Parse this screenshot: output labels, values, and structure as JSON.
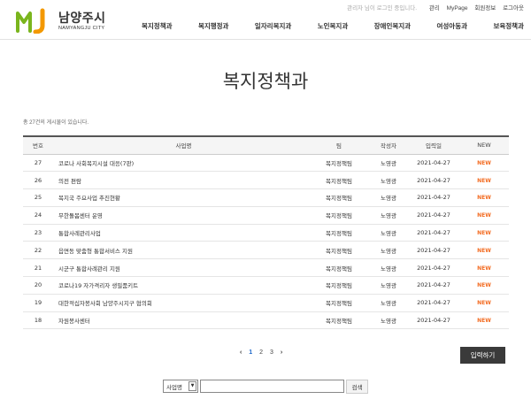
{
  "brand": {
    "name": "남양주시",
    "sub": "NAMYANGJU CITY",
    "mark_letters": "MJ",
    "colors": {
      "green": "#7ab51d",
      "orange": "#f39800"
    }
  },
  "util": {
    "welcome": "관리자 님이 로그인 중입니다.",
    "links": [
      "관리",
      "MyPage",
      "회원정보",
      "로그아웃"
    ]
  },
  "nav": [
    "복지정책과",
    "복지행정과",
    "일자리복지과",
    "노인복지과",
    "장애인복지과",
    "여성아동과",
    "보육정책과"
  ],
  "page": {
    "title": "복지정책과",
    "total_text": "총 27건의 게시물이 있습니다."
  },
  "table": {
    "headers": [
      "번호",
      "사업명",
      "팀",
      "작성자",
      "입력일",
      "NEW"
    ],
    "rows": [
      {
        "num": "27",
        "name": "코로나 사회복지시설 대응(7판)",
        "team": "복지정책팀",
        "writer": "노영광",
        "date": "2021-04-27",
        "new": "NEW"
      },
      {
        "num": "26",
        "name": "의전 편람",
        "team": "복지정책팀",
        "writer": "노영광",
        "date": "2021-04-27",
        "new": "NEW"
      },
      {
        "num": "25",
        "name": "복지국 주요사업 추진현황",
        "team": "복지정책팀",
        "writer": "노영광",
        "date": "2021-04-27",
        "new": "NEW"
      },
      {
        "num": "24",
        "name": "무한돌봄센터 운영",
        "team": "복지정책팀",
        "writer": "노영광",
        "date": "2021-04-27",
        "new": "NEW"
      },
      {
        "num": "23",
        "name": "통합사례관리사업",
        "team": "복지정책팀",
        "writer": "노영광",
        "date": "2021-04-27",
        "new": "NEW"
      },
      {
        "num": "22",
        "name": "읍면동 맞춤형 통합서비스 지원",
        "team": "복지정책팀",
        "writer": "노영광",
        "date": "2021-04-27",
        "new": "NEW"
      },
      {
        "num": "21",
        "name": "시군구 통합사례관리 지원",
        "team": "복지정책팀",
        "writer": "노영광",
        "date": "2021-04-27",
        "new": "NEW"
      },
      {
        "num": "20",
        "name": "코로나19 자가격리자 생필품키트",
        "team": "복지정책팀",
        "writer": "노영광",
        "date": "2021-04-27",
        "new": "NEW"
      },
      {
        "num": "19",
        "name": "대한적십자봉사회 남양주시지구 협의회",
        "team": "복지정책팀",
        "writer": "노영광",
        "date": "2021-04-27",
        "new": "NEW"
      },
      {
        "num": "18",
        "name": "자원봉사센터",
        "team": "복지정책팀",
        "writer": "노영광",
        "date": "2021-04-27",
        "new": "NEW"
      }
    ]
  },
  "pager": {
    "prev": "‹",
    "pages": [
      "1",
      "2",
      "3"
    ],
    "current": "1",
    "next": "›"
  },
  "write_button": "입력하기",
  "search": {
    "field_option": "사업명",
    "query": "",
    "button": "검색"
  }
}
